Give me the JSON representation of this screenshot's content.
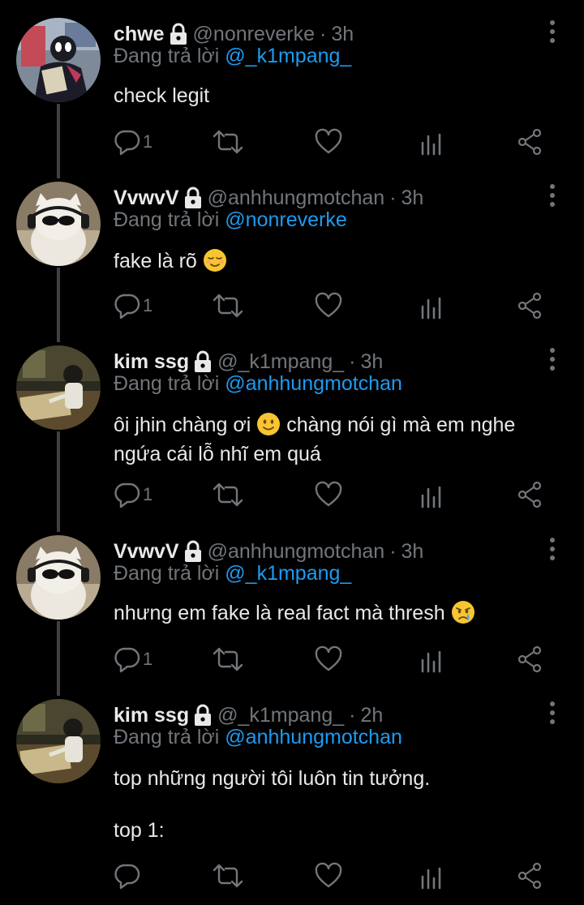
{
  "tweets": [
    {
      "name": "chwe",
      "handle": "@nonreverke",
      "sep": "·",
      "time": "3h",
      "reply_prefix": "Đang trả lời",
      "reply_to": "@_k1mpang_",
      "text": "check legit",
      "reply_count": "1"
    },
    {
      "name": "VvwvV",
      "handle": "@anhhungmotchan",
      "sep": "·",
      "time": "3h",
      "reply_prefix": "Đang trả lời",
      "reply_to": "@nonreverke",
      "text": "fake là rõ",
      "reply_count": "1"
    },
    {
      "name": "kim ssg",
      "handle": "@_k1mpang_",
      "sep": "·",
      "time": "3h",
      "reply_prefix": "Đang trả lời",
      "reply_to": "@anhhungmotchan",
      "text_a": "ôi jhin chàng ơi",
      "text_b": "chàng nói gì mà em nghe",
      "text_c": "ngứa cái lỗ nhĩ em quá",
      "reply_count": "1"
    },
    {
      "name": "VvwvV",
      "handle": "@anhhungmotchan",
      "sep": "·",
      "time": "3h",
      "reply_prefix": "Đang trả lời",
      "reply_to": "@_k1mpang_",
      "text": "nhưng em fake là real fact mà thresh",
      "reply_count": "1"
    },
    {
      "name": "kim ssg",
      "handle": "@_k1mpang_",
      "sep": "·",
      "time": "2h",
      "reply_prefix": "Đang trả lời",
      "reply_to": "@anhhungmotchan",
      "text": "top những người tôi luôn tin tưởng.",
      "text2": "top 1:",
      "reply_count": ""
    }
  ],
  "icons": {
    "lock": "lock-icon",
    "more": "more-vertical-icon",
    "reply": "reply-icon",
    "retweet": "retweet-icon",
    "like": "heart-icon",
    "views": "views-chart-icon",
    "share": "share-icon"
  },
  "colors": {
    "background": "#000000",
    "text": "#e7e9ea",
    "muted": "#71767b",
    "link": "#1d9bf0",
    "thread": "#3d4144"
  }
}
